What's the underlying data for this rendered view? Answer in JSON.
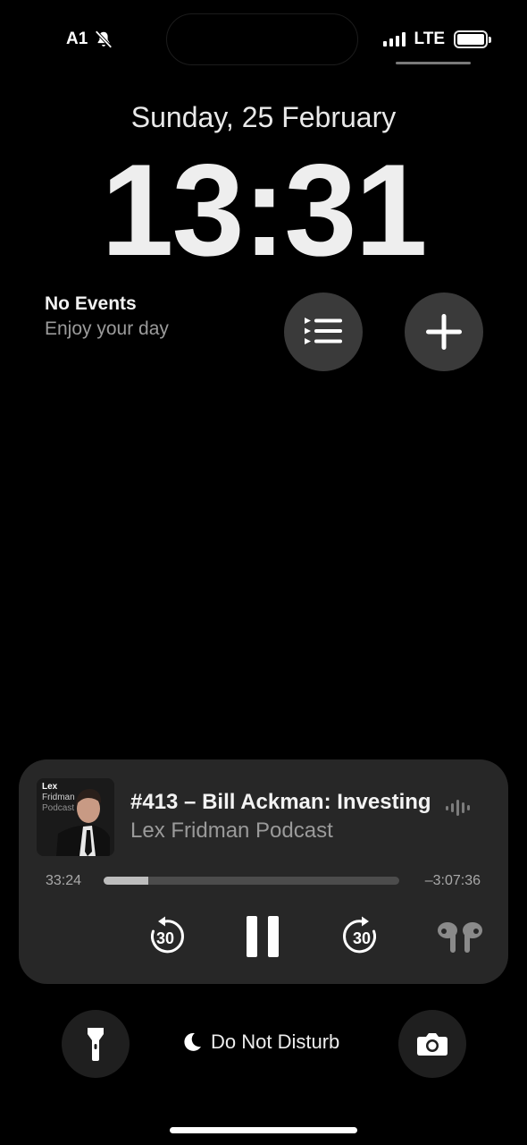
{
  "status_bar": {
    "carrier": "A1",
    "network": "LTE",
    "signal_bars": 4,
    "battery_level": 1.0
  },
  "lock_screen": {
    "date": "Sunday, 25 February",
    "time": "13:31"
  },
  "calendar_widget": {
    "title": "No Events",
    "subtitle": "Enjoy your day"
  },
  "widget_buttons": [
    {
      "icon": "list-icon"
    },
    {
      "icon": "plus-icon"
    }
  ],
  "now_playing": {
    "artwork": {
      "line1": "Lex",
      "line2": "Fridman",
      "line3": "Podcast"
    },
    "title": "#413 – Bill Ackman: Investing",
    "artist": "Lex Fridman Podcast",
    "elapsed": "33:24",
    "remaining": "–3:07:36",
    "progress_fraction": 0.15,
    "skip_back_seconds": "30",
    "skip_forward_seconds": "30",
    "output_icon": "airpods-icon"
  },
  "bottom_bar": {
    "focus_label": "Do Not Disturb",
    "left_icon": "flashlight-icon",
    "right_icon": "camera-icon"
  },
  "colors": {
    "background": "#000000",
    "player_card": "#272727",
    "widget_button": "#3a3a3a",
    "secondary_text": "#9a9a9a"
  }
}
